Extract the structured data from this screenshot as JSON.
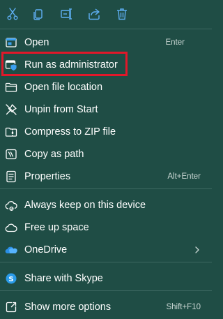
{
  "toolbar": {
    "buttons": [
      {
        "icon": "cut-icon"
      },
      {
        "icon": "copy-icon"
      },
      {
        "icon": "rename-icon"
      },
      {
        "icon": "share-icon"
      },
      {
        "icon": "delete-icon"
      }
    ]
  },
  "menu": {
    "open": {
      "label": "Open",
      "shortcut": "Enter",
      "icon": "open-icon"
    },
    "run_as_admin": {
      "label": "Run as administrator",
      "icon": "shield-icon"
    },
    "open_file_location": {
      "label": "Open file location",
      "icon": "folder-icon"
    },
    "unpin_from_start": {
      "label": "Unpin from Start",
      "icon": "unpin-icon"
    },
    "compress_zip": {
      "label": "Compress to ZIP file",
      "icon": "zip-folder-icon"
    },
    "copy_as_path": {
      "label": "Copy as path",
      "icon": "path-icon"
    },
    "properties": {
      "label": "Properties",
      "shortcut": "Alt+Enter",
      "icon": "properties-icon"
    },
    "always_keep": {
      "label": "Always keep on this device",
      "icon": "cloud-sync-icon"
    },
    "free_up_space": {
      "label": "Free up space",
      "icon": "cloud-icon"
    },
    "onedrive": {
      "label": "OneDrive",
      "icon": "onedrive-icon"
    },
    "share_skype": {
      "label": "Share with Skype",
      "icon": "skype-icon"
    },
    "show_more": {
      "label": "Show more options",
      "shortcut": "Shift+F10",
      "icon": "more-options-icon"
    }
  },
  "colors": {
    "background": "#1f4d45",
    "divider": "#3d6861",
    "highlight": "#e1182a",
    "accent": "#3aa0f0"
  }
}
